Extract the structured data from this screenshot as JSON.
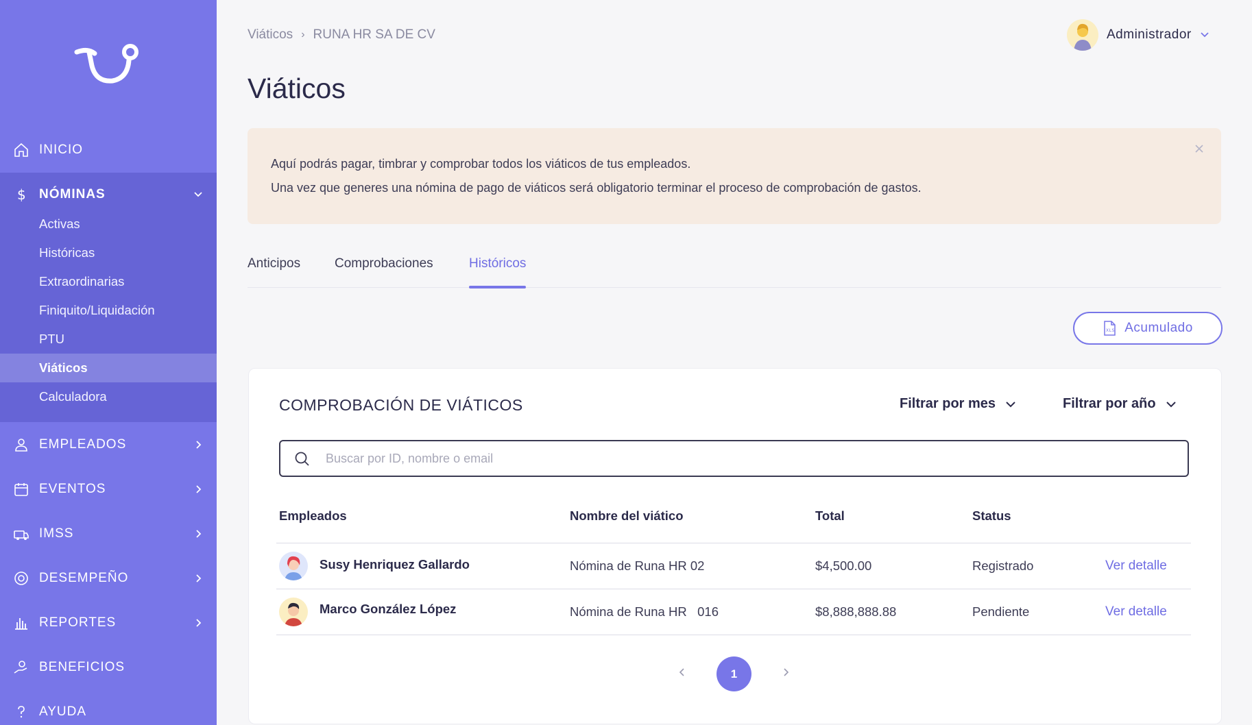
{
  "sidebar": {
    "top_items": [
      {
        "label": "INICIO",
        "icon": "home-icon"
      }
    ],
    "nominas": {
      "label": "NÓMINAS",
      "icon": "dollar-icon",
      "sub_items": [
        "Activas",
        "Históricas",
        "Extraordinarias",
        "Finiquito/Liquidación",
        "PTU",
        "Viáticos",
        "Calculadora"
      ],
      "active": "Viáticos"
    },
    "items": [
      {
        "label": "EMPLEADOS",
        "icon": "user-icon"
      },
      {
        "label": "EVENTOS",
        "icon": "calendar-icon"
      },
      {
        "label": "IMSS",
        "icon": "ambulance-icon"
      },
      {
        "label": "DESEMPEÑO",
        "icon": "target-icon"
      },
      {
        "label": "REPORTES",
        "icon": "bar-chart-icon"
      },
      {
        "label": "BENEFICIOS",
        "icon": "gift-hand-icon"
      },
      {
        "label": "AYUDA",
        "icon": "question-icon"
      }
    ]
  },
  "header": {
    "breadcrumb": [
      "Viáticos",
      "RUNA HR SA DE CV"
    ],
    "user": "Administrador",
    "title": "Viáticos"
  },
  "banner": {
    "line1": "Aquí podrás pagar, timbrar y comprobar todos los viáticos de tus empleados.",
    "line2": "Una vez que generes una nómina de pago de viáticos será obligatorio terminar el proceso de comprobación de gastos."
  },
  "tabs": [
    "Anticipos",
    "Comprobaciones",
    "Históricos"
  ],
  "active_tab": "Históricos",
  "acumulado_label": "Acumulado",
  "card": {
    "title": "COMPROBACIÓN DE VIÁTICOS",
    "filter_month": "Filtrar por mes",
    "filter_year": "Filtrar por año",
    "search_placeholder": "Buscar por ID, nombre o email",
    "columns": [
      "Empleados",
      "Nombre del viático",
      "Total",
      "Status"
    ],
    "rows": [
      {
        "name": "Susy Henriquez Gallardo",
        "viatico": "Nómina de Runa HR 02",
        "total": "$4,500.00",
        "status": "Registrado",
        "action": "Ver detalle"
      },
      {
        "name": "Marco González López",
        "viatico": "Nómina de Runa HR   016",
        "total": "$8,888,888.88",
        "status": "Pendiente",
        "action": "Ver detalle"
      }
    ],
    "page": "1"
  },
  "colors": {
    "sidebar": "#7876e8",
    "sidebar_group": "#6664d6",
    "accent": "#6f6de3",
    "banner": "#f6ebe2"
  }
}
